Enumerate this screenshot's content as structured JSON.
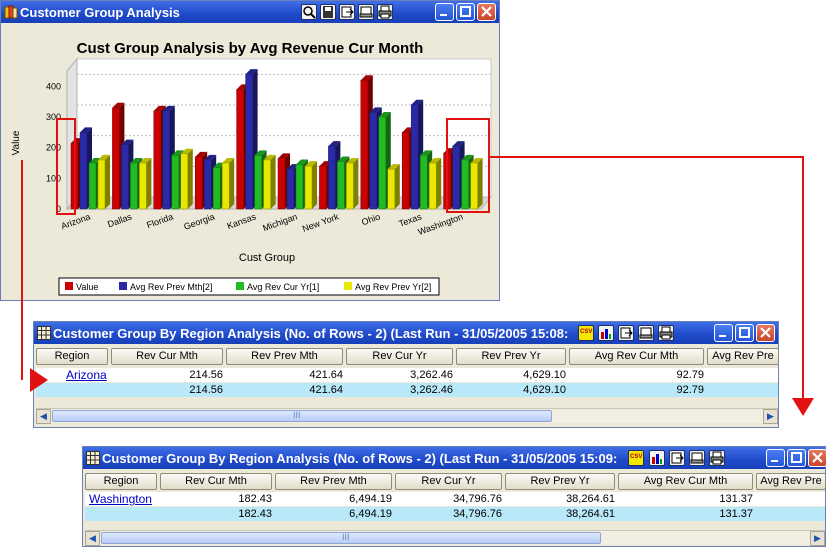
{
  "chart_window": {
    "title": "Customer Group Analysis",
    "toolbar_icons": [
      "zoom-icon",
      "save-icon",
      "export-icon",
      "preview-icon",
      "print-icon"
    ]
  },
  "chart_data": {
    "type": "bar",
    "title": "Cust Group Analysis by Avg Revenue Cur Month",
    "xlabel": "Cust Group",
    "ylabel": "Value",
    "ylim": [
      0,
      450
    ],
    "yticks": [
      0,
      100,
      200,
      300,
      400
    ],
    "categories": [
      "Arizona",
      "Dallas",
      "Florida",
      "Georgia",
      "Kansas",
      "Michigan",
      "New York",
      "Ohio",
      "Texas",
      "Washington"
    ],
    "series": [
      {
        "name": "Value",
        "color": "#cc0000",
        "values": [
          215,
          330,
          320,
          170,
          390,
          165,
          140,
          420,
          250,
          182
        ]
      },
      {
        "name": "Avg Rev Prev Mth[2]",
        "color": "#2a2aa8",
        "values": [
          250,
          210,
          320,
          160,
          440,
          130,
          205,
          315,
          340,
          205
        ]
      },
      {
        "name": "Avg Rev Cur Yr[1]",
        "color": "#22bb22",
        "values": [
          150,
          150,
          175,
          135,
          175,
          145,
          155,
          300,
          175,
          160
        ]
      },
      {
        "name": "Avg Rev Prev Yr[2]",
        "color": "#e8e800",
        "values": [
          160,
          150,
          180,
          150,
          160,
          140,
          150,
          130,
          150,
          150
        ]
      }
    ],
    "legend_position": "bottom"
  },
  "table1": {
    "title": "Customer Group By Region Analysis  (No. of Rows - 2) (Last Run - 31/05/2005 15:08:",
    "headers": [
      "Region",
      "Rev Cur Mth",
      "Rev Prev Mth",
      "Rev Cur Yr",
      "Rev Prev Yr",
      "Avg Rev Cur Mth",
      "Avg Rev Pre"
    ],
    "rows": [
      [
        "Arizona",
        "214.56",
        "421.64",
        "3,262.46",
        "4,629.10",
        "92.79"
      ],
      [
        "",
        "214.56",
        "421.64",
        "3,262.46",
        "4,629.10",
        "92.79"
      ]
    ]
  },
  "table2": {
    "title": "Customer Group By Region Analysis  (No. of Rows - 2) (Last Run - 31/05/2005 15:09:",
    "headers": [
      "Region",
      "Rev Cur Mth",
      "Rev Prev Mth",
      "Rev Cur Yr",
      "Rev Prev Yr",
      "Avg Rev Cur Mth",
      "Avg Rev Pre"
    ],
    "rows": [
      [
        "Washington",
        "182.43",
        "6,494.19",
        "34,796.76",
        "38,264.61",
        "131.37"
      ],
      [
        "",
        "182.43",
        "6,494.19",
        "34,796.76",
        "38,264.61",
        "131.37"
      ]
    ]
  },
  "toolbar": {
    "csv_label": "CSV"
  },
  "scroll": {
    "grip": "III"
  },
  "colors": {
    "callout": "#e11111",
    "title_bar": "#1f49c9",
    "row_highlight": "#b9e8f8"
  }
}
